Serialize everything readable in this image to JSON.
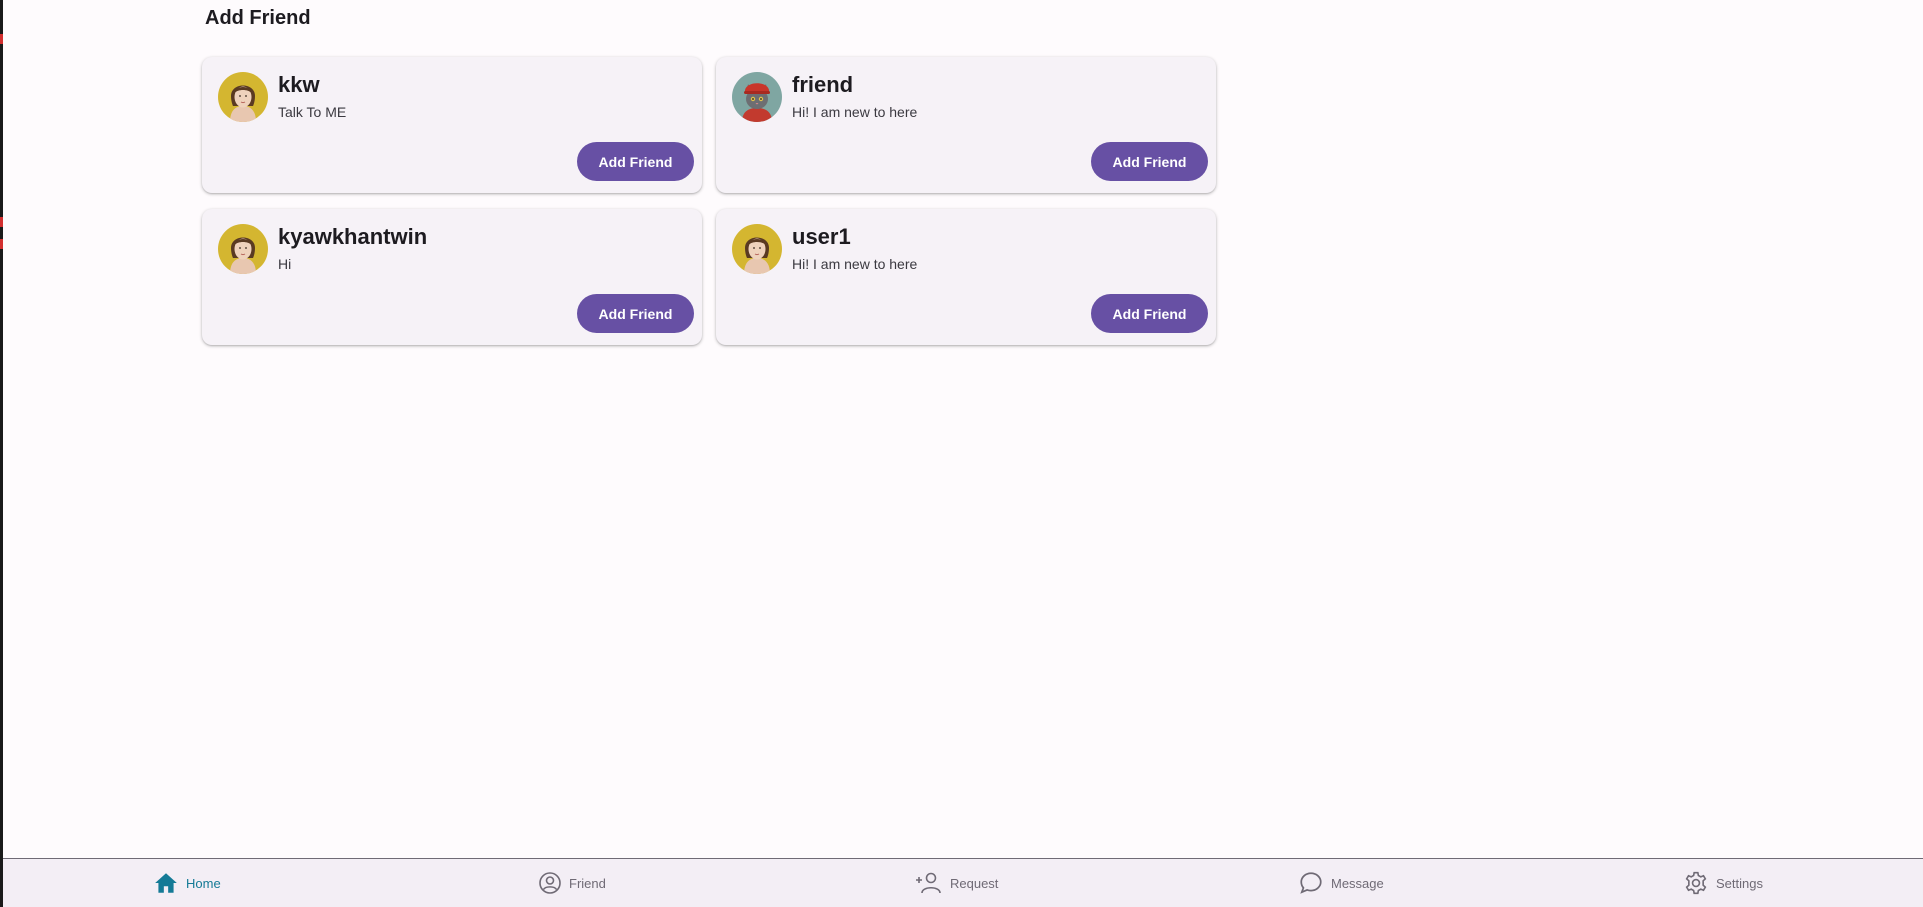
{
  "page": {
    "title": "Add Friend"
  },
  "users": [
    {
      "name": "kkw",
      "bio": "Talk To ME",
      "avatar": "woman-portrait-avatar",
      "button_label": "Add Friend"
    },
    {
      "name": "friend",
      "bio": "Hi! I am new to here",
      "avatar": "cat-portrait-avatar",
      "button_label": "Add Friend"
    },
    {
      "name": "kyawkhantwin",
      "bio": "Hi",
      "avatar": "woman-portrait-avatar",
      "button_label": "Add Friend"
    },
    {
      "name": "user1",
      "bio": "Hi! I am new to here",
      "avatar": "woman-portrait-avatar",
      "button_label": "Add Friend"
    }
  ],
  "bottom_nav": {
    "items": [
      {
        "label": "Home",
        "icon": "home-icon",
        "active": true
      },
      {
        "label": "Friend",
        "icon": "account-circle-icon",
        "active": false
      },
      {
        "label": "Request",
        "icon": "person-add-icon",
        "active": false
      },
      {
        "label": "Message",
        "icon": "chat-bubble-icon",
        "active": false
      },
      {
        "label": "Settings",
        "icon": "gear-icon",
        "active": false
      }
    ]
  },
  "colors": {
    "background": "#fefbfd",
    "card": "#f6f2f7",
    "primary_button": "#6750a4",
    "nav_active": "#147a96",
    "nav_inactive": "#6f6a75"
  }
}
